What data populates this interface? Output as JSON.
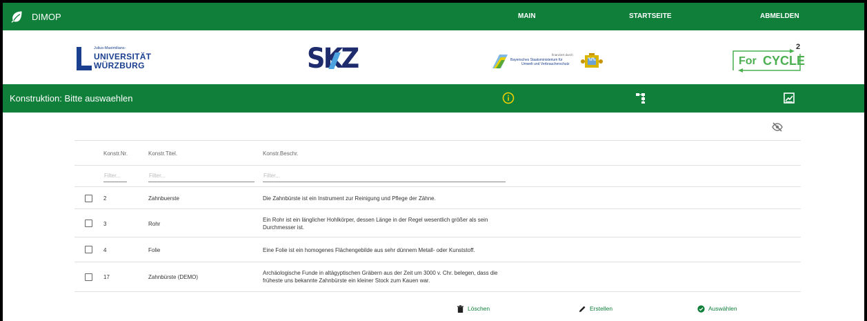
{
  "app": {
    "name": "DIMOP"
  },
  "nav": {
    "items": [
      "MAIN",
      "STARTSEITE",
      "ABMELDEN"
    ]
  },
  "logos": {
    "wuerzburg": {
      "small": "Julius-Maximilians-",
      "line1": "UNIVERSITÄT",
      "line2": "WÜRZBURG"
    },
    "skz": {
      "text_s": "S",
      "text_kz": "KZ"
    },
    "ministry": {
      "line1": "finanziert durch",
      "line2": "Bayerisches Staatsministerium für",
      "line3": "Umwelt und Verbraucherschutz"
    },
    "forcycle": {
      "for": "For",
      "cycle": "CYCLE",
      "sup": "2"
    }
  },
  "section": {
    "title": "Konstruktion: Bitte auswaehlen"
  },
  "table": {
    "columns": [
      "Konstr.Nr.",
      "Konstr.Titel.",
      "Konstr.Beschr."
    ],
    "filter_placeholder": "Filter...",
    "rows": [
      {
        "nr": "2",
        "titel": "Zahnbuerste",
        "beschr": "Die Zahnbürste ist ein Instrument zur Reinigung und Pflege der Zähne."
      },
      {
        "nr": "3",
        "titel": "Rohr",
        "beschr": "Ein Rohr ist ein länglicher Hohlkörper, dessen Länge in der Regel wesentlich größer als sein Durchmesser ist."
      },
      {
        "nr": "4",
        "titel": "Folie",
        "beschr": "Eine Folie ist ein homogenes Flächengebilde aus sehr dünnem Metall- oder Kunststoff."
      },
      {
        "nr": "17",
        "titel": "Zahnbürste (DEMO)",
        "beschr": "Archäologische Funde in altägyptischen Gräbern aus der Zeit um 3000 v. Chr. belegen, dass die früheste uns bekannte Zahnbürste ein kleiner Stock zum Kauen war."
      }
    ]
  },
  "actions": {
    "delete": "Löschen",
    "create": "Erstellen",
    "select": "Auswählen"
  },
  "colors": {
    "brand_green": "#0f7f3a",
    "info_yellow": "#f2d000",
    "uni_blue": "#1a3f8f"
  }
}
